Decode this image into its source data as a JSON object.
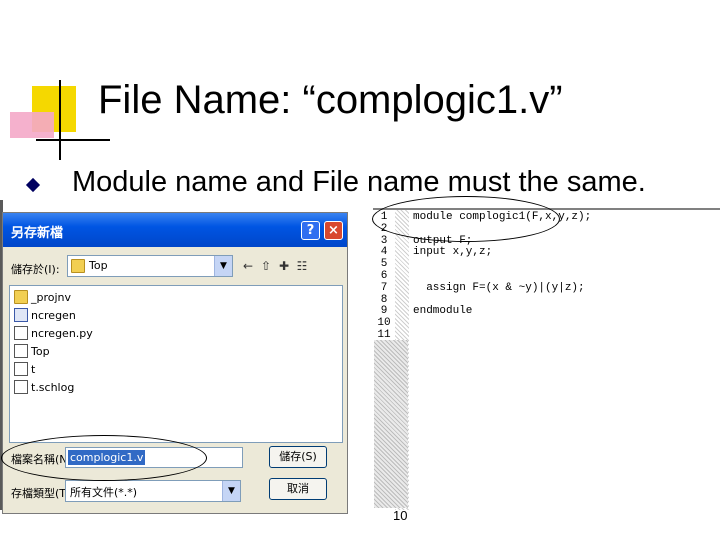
{
  "slide": {
    "title": "File Name: “complogic1.v”",
    "bullet": "Module name and File name must the same.",
    "page_number": "10"
  },
  "dialog": {
    "title": "另存新檔",
    "save_in_label": "儲存於(I):",
    "save_in_value": "Top",
    "files": [
      {
        "name": "_projnv",
        "icon": "folder-icon"
      },
      {
        "name": "ncregen",
        "icon": "exe-icon"
      },
      {
        "name": "ncregen.py",
        "icon": "doc-icon"
      },
      {
        "name": "Top",
        "icon": "doc-icon"
      },
      {
        "name": "t",
        "icon": "doc-icon"
      },
      {
        "name": "t.schlog",
        "icon": "doc-icon"
      }
    ],
    "filename_label": "檔案名稱(N):",
    "filename_value": "complogic1.v",
    "filetype_label": "存檔類型(T):",
    "filetype_value": "所有文件(*.*)",
    "save_button": "儲存(S)",
    "cancel_button": "取消",
    "help_button": "?",
    "close_button": "×"
  },
  "editor": {
    "line_numbers": [
      "1",
      "2",
      "3",
      "4",
      "5",
      "6",
      "7",
      "8",
      "9",
      "10",
      "11"
    ],
    "lines": [
      "module complogic1(F,x,y,z);",
      "",
      "output F;",
      "input x,y,z;",
      "",
      "",
      "  assign F=(x & ~y)|(y|z);",
      "",
      "endmodule",
      "",
      ""
    ]
  },
  "colors": {
    "titlebar": "#0055e3",
    "dialog_bg": "#ece9d8",
    "selection": "#316ac5"
  }
}
